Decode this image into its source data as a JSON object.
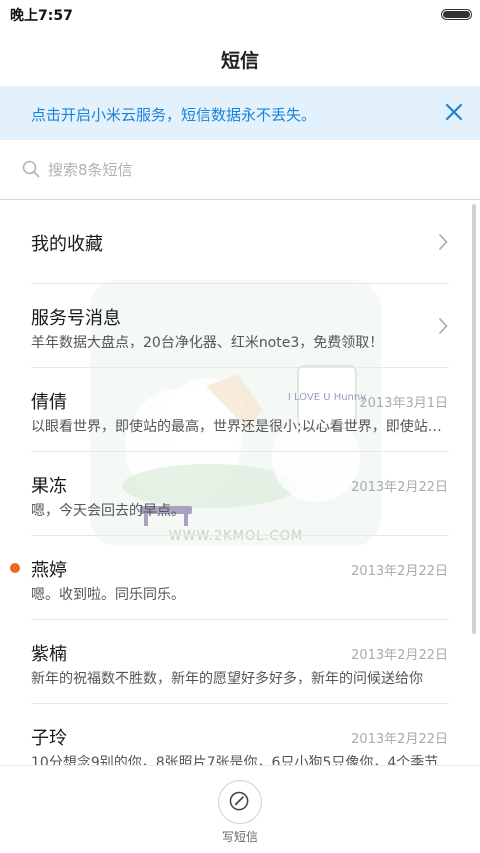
{
  "status_bar": {
    "time": "晚上7:57"
  },
  "header": {
    "title": "短信"
  },
  "banner": {
    "text": "点击开启小米云服务，短信数据永不丢失。"
  },
  "search": {
    "placeholder": "搜索8条短信",
    "value": ""
  },
  "watermark": {
    "card_text": "I LOVE U Hunny",
    "site_text": "WWW.2KMOL.COM"
  },
  "messages": [
    {
      "name": "我的收藏",
      "preview": "",
      "date": ""
    },
    {
      "name": "服务号消息",
      "preview": "羊年数据大盘点，20台净化器、红米note3，免费领取！",
      "date": ""
    },
    {
      "name": "倩倩",
      "preview": "以眼看世界，即使站的最高，世界还是很小;以心看世界，即使站的最低，世界也是很大",
      "date": "2013年3月1日"
    },
    {
      "name": "果冻",
      "preview": "嗯，今天会回去的早点。",
      "date": "2013年2月22日"
    },
    {
      "name": "燕婷",
      "preview": "嗯。收到啦。同乐同乐。",
      "date": "2013年2月22日",
      "unread": true
    },
    {
      "name": "紫楠",
      "preview": "新年的祝福数不胜数，新年的愿望好多好多，新年的问候送给你",
      "date": "2013年2月22日"
    },
    {
      "name": "子玲",
      "preview": "10分想念9别的你，8张照片7张是你，6只小狗5只像你，4个季节",
      "date": "2013年2月22日"
    }
  ],
  "bottom": {
    "compose_label": "写短信"
  },
  "colors": {
    "accent": "#1a82d8",
    "banner_bg": "#e3f1fc",
    "unread": "#f26522"
  }
}
